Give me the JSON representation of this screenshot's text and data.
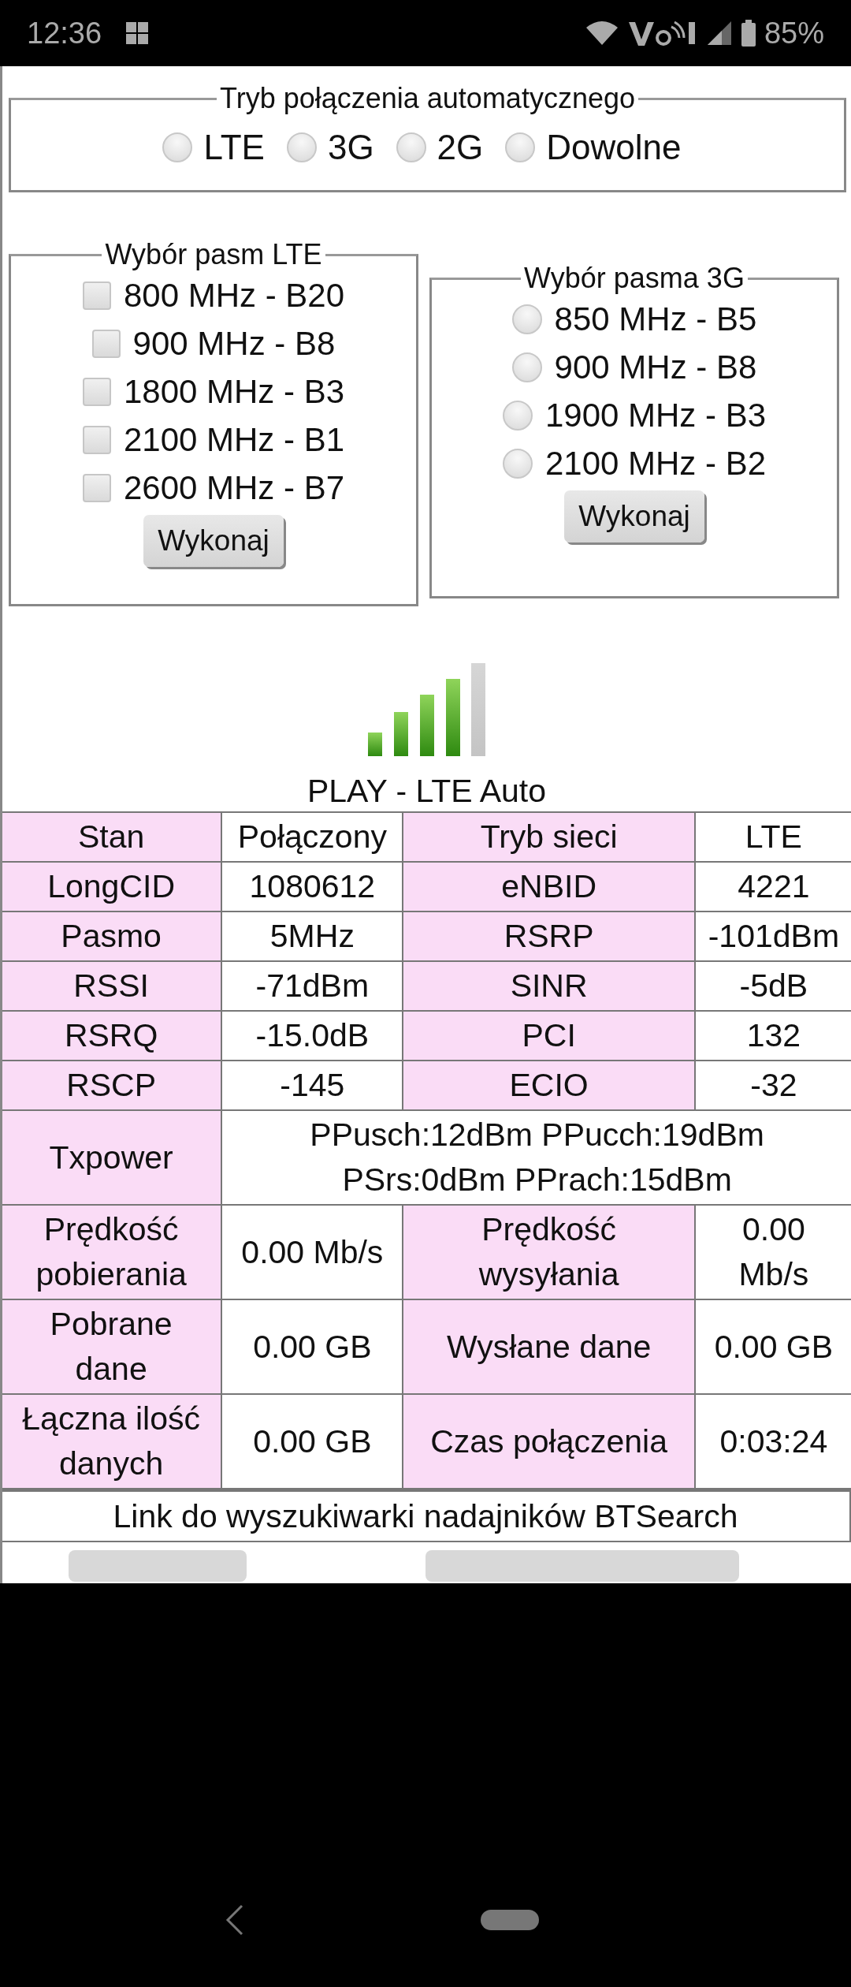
{
  "status_bar": {
    "time": "12:36",
    "battery": "85%"
  },
  "auto_mode": {
    "title": "Tryb połączenia automatycznego",
    "options": [
      {
        "label": "LTE",
        "selected": false
      },
      {
        "label": "3G",
        "selected": false
      },
      {
        "label": "2G",
        "selected": false
      },
      {
        "label": "Dowolne",
        "selected": false
      }
    ]
  },
  "lte_bands": {
    "title": "Wybór pasm LTE",
    "options": [
      {
        "label": "800 MHz - B20",
        "checked": false
      },
      {
        "label": "900 MHz - B8",
        "checked": false
      },
      {
        "label": "1800 MHz - B3",
        "checked": false
      },
      {
        "label": "2100 MHz - B1",
        "checked": false
      },
      {
        "label": "2600 MHz - B7",
        "checked": false
      }
    ],
    "button": "Wykonaj"
  },
  "umts_bands": {
    "title": "Wybór pasma 3G",
    "options": [
      {
        "label": "850 MHz - B5",
        "selected": false
      },
      {
        "label": "900 MHz - B8",
        "selected": false
      },
      {
        "label": "1900 MHz - B3",
        "selected": false
      },
      {
        "label": "2100 MHz - B2",
        "selected": false
      }
    ],
    "button": "Wykonaj"
  },
  "network_name": "PLAY - LTE Auto",
  "table": {
    "rows": [
      {
        "cells": [
          {
            "kind": "label",
            "text": "Stan"
          },
          {
            "kind": "value",
            "text": "Połączony"
          },
          {
            "kind": "label",
            "text": "Tryb sieci"
          },
          {
            "kind": "value",
            "text": "LTE"
          }
        ]
      },
      {
        "cells": [
          {
            "kind": "label",
            "text": "LongCID"
          },
          {
            "kind": "value",
            "text": "1080612"
          },
          {
            "kind": "label",
            "text": "eNBID"
          },
          {
            "kind": "value",
            "text": "4221"
          }
        ]
      },
      {
        "cells": [
          {
            "kind": "label",
            "text": "Pasmo"
          },
          {
            "kind": "value",
            "text": "5MHz"
          },
          {
            "kind": "label",
            "text": "RSRP"
          },
          {
            "kind": "value",
            "text": "-101dBm"
          }
        ]
      },
      {
        "cells": [
          {
            "kind": "label",
            "text": "RSSI"
          },
          {
            "kind": "value",
            "text": "-71dBm"
          },
          {
            "kind": "label",
            "text": "SINR"
          },
          {
            "kind": "value",
            "text": "-5dB"
          }
        ]
      },
      {
        "cells": [
          {
            "kind": "label",
            "text": "RSRQ"
          },
          {
            "kind": "value",
            "text": "-15.0dB"
          },
          {
            "kind": "label",
            "text": "PCI"
          },
          {
            "kind": "value",
            "text": "132"
          }
        ]
      },
      {
        "cells": [
          {
            "kind": "label",
            "text": "RSCP"
          },
          {
            "kind": "value",
            "text": "-145"
          },
          {
            "kind": "label",
            "text": "ECIO"
          },
          {
            "kind": "value",
            "text": "-32"
          }
        ]
      },
      {
        "cells": [
          {
            "kind": "label",
            "text": "Txpower"
          },
          {
            "kind": "wide",
            "colspan": 3,
            "lines": [
              "PPusch:12dBm PPucch:19dBm",
              "PSrs:0dBm PPrach:15dBm"
            ]
          }
        ]
      },
      {
        "cells": [
          {
            "kind": "label",
            "text": "Prędkość pobierania"
          },
          {
            "kind": "value",
            "text": "0.00 Mb/s"
          },
          {
            "kind": "label",
            "text": "Prędkość wysyłania"
          },
          {
            "kind": "value",
            "text": "0.00 Mb/s"
          }
        ]
      },
      {
        "cells": [
          {
            "kind": "label",
            "text": "Pobrane dane"
          },
          {
            "kind": "value",
            "text": "0.00 GB"
          },
          {
            "kind": "label",
            "text": "Wysłane dane"
          },
          {
            "kind": "value",
            "text": "0.00 GB"
          }
        ]
      },
      {
        "cells": [
          {
            "kind": "label",
            "text": "Łączna ilość danych"
          },
          {
            "kind": "value",
            "text": "0.00 GB"
          },
          {
            "kind": "label",
            "text": "Czas połączenia"
          },
          {
            "kind": "value",
            "text": "0:03:24"
          }
        ]
      }
    ]
  },
  "link": "Link do wyszukiwarki nadajników BTSearch"
}
